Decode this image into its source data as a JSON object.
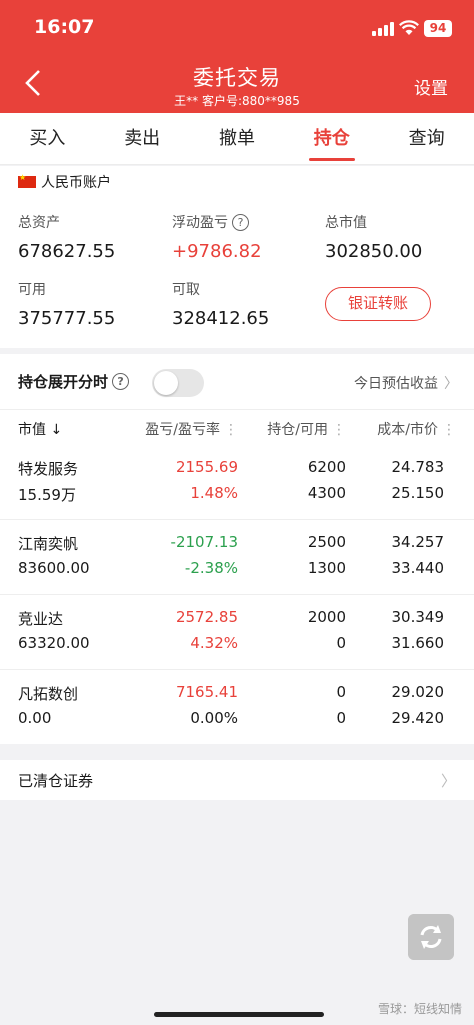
{
  "status_bar": {
    "time": "16:07",
    "battery": "94"
  },
  "header": {
    "title": "委托交易",
    "subtitle": "王**    客户号:880**985",
    "settings_label": "设置"
  },
  "tabs": [
    {
      "label": "买入",
      "active": false
    },
    {
      "label": "卖出",
      "active": false
    },
    {
      "label": "撤单",
      "active": false
    },
    {
      "label": "持仓",
      "active": true
    },
    {
      "label": "查询",
      "active": false
    }
  ],
  "account": {
    "label": "人民币账户",
    "total_assets_label": "总资产",
    "total_assets": "678627.55",
    "float_pnl_label": "浮动盈亏",
    "float_pnl": "+9786.82",
    "market_value_label": "总市值",
    "market_value": "302850.00",
    "available_label": "可用",
    "available": "375777.55",
    "withdrawable_label": "可取",
    "withdrawable": "328412.65",
    "transfer_button": "银证转账"
  },
  "holdings": {
    "title": "持仓展开分时",
    "estimate_label": "今日预估收益",
    "columns": {
      "col1": "市值 ↓",
      "col2": "盈亏/盈亏率",
      "col3": "持仓/可用",
      "col4": "成本/市价"
    },
    "rows": [
      {
        "name": "特发服务",
        "value": "15.59万",
        "pnl": "2155.69",
        "pnl_rate": "1.48%",
        "position": "6200",
        "available": "4300",
        "cost": "24.783",
        "price": "25.150",
        "direction": "up"
      },
      {
        "name": "江南奕帆",
        "value": "83600.00",
        "pnl": "-2107.13",
        "pnl_rate": "-2.38%",
        "position": "2500",
        "available": "1300",
        "cost": "34.257",
        "price": "33.440",
        "direction": "down"
      },
      {
        "name": "竞业达",
        "value": "63320.00",
        "pnl": "2572.85",
        "pnl_rate": "4.32%",
        "position": "2000",
        "available": "0",
        "cost": "30.349",
        "price": "31.660",
        "direction": "up"
      },
      {
        "name": "凡拓数创",
        "value": "0.00",
        "pnl": "7165.41",
        "pnl_rate": "0.00%",
        "position": "0",
        "available": "0",
        "cost": "29.020",
        "price": "29.420",
        "direction": "up"
      }
    ]
  },
  "cleared_label": "已清仓证券",
  "watermark": "雪球：短线知情",
  "colors": {
    "brand_red": "#e8413a",
    "loss_green": "#2ca04e"
  }
}
